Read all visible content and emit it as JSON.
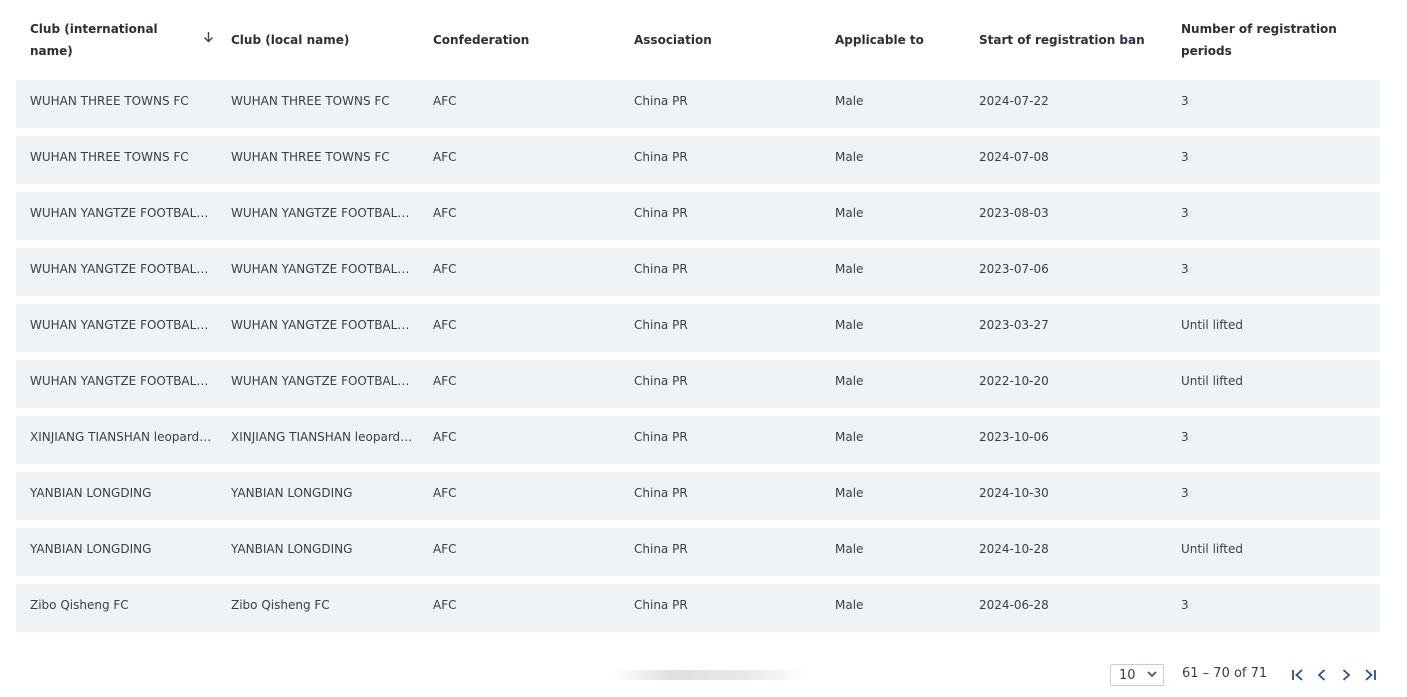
{
  "table": {
    "columns": [
      "Club (international name)",
      "Club (local name)",
      "Confederation",
      "Association",
      "Applicable to",
      "Start of registration ban",
      "Number of registration periods"
    ],
    "sort_icon": "arrow-down-icon",
    "rows": [
      [
        "WUHAN THREE TOWNS FC",
        "WUHAN THREE TOWNS FC",
        "AFC",
        "China PR",
        "Male",
        "2024-07-22",
        "3"
      ],
      [
        "WUHAN THREE TOWNS FC",
        "WUHAN THREE TOWNS FC",
        "AFC",
        "China PR",
        "Male",
        "2024-07-08",
        "3"
      ],
      [
        "WUHAN YANGTZE FOOTBALL ...",
        "WUHAN YANGTZE FOOTBALL ...",
        "AFC",
        "China PR",
        "Male",
        "2023-08-03",
        "3"
      ],
      [
        "WUHAN YANGTZE FOOTBALL ...",
        "WUHAN YANGTZE FOOTBALL ...",
        "AFC",
        "China PR",
        "Male",
        "2023-07-06",
        "3"
      ],
      [
        "WUHAN YANGTZE FOOTBALL ...",
        "WUHAN YANGTZE FOOTBALL ...",
        "AFC",
        "China PR",
        "Male",
        "2023-03-27",
        "Until lifted"
      ],
      [
        "WUHAN YANGTZE FOOTBALL ...",
        "WUHAN YANGTZE FOOTBALL ...",
        "AFC",
        "China PR",
        "Male",
        "2022-10-20",
        "Until lifted"
      ],
      [
        "XINJIANG TIANSHAN leopard f...",
        "XINJIANG TIANSHAN leopard f...",
        "AFC",
        "China PR",
        "Male",
        "2023-10-06",
        "3"
      ],
      [
        "YANBIAN LONGDING",
        "YANBIAN LONGDING",
        "AFC",
        "China PR",
        "Male",
        "2024-10-30",
        "3"
      ],
      [
        "YANBIAN LONGDING",
        "YANBIAN LONGDING",
        "AFC",
        "China PR",
        "Male",
        "2024-10-28",
        "Until lifted"
      ],
      [
        "Zibo Qisheng FC",
        "Zibo Qisheng FC",
        "AFC",
        "China PR",
        "Male",
        "2024-06-28",
        "3"
      ]
    ]
  },
  "pagination": {
    "page_size": "10",
    "range_text": "61 – 70 of 71",
    "icons": [
      "first-page-icon",
      "previous-page-icon",
      "next-page-icon",
      "last-page-icon"
    ],
    "icon_color": "#2d4e80"
  },
  "colors": {
    "row_background": "#eff2f6",
    "text": "#3a3f47"
  }
}
